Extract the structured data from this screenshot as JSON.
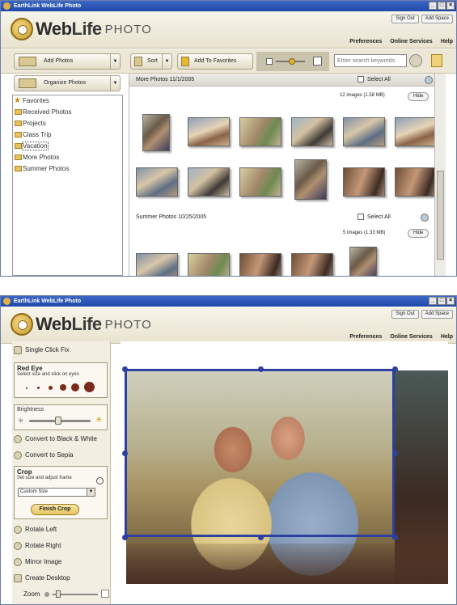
{
  "window1": {
    "title": "EarthLink WebLife Photo",
    "window_buttons": [
      "_",
      "□",
      "×"
    ],
    "logo": {
      "web": "Web",
      "life": "Life",
      "photo": "PHOTO"
    },
    "top_links": [
      "Sign Out",
      "Add Space"
    ],
    "nav_links": [
      "Preferences",
      "Online Services",
      "Help"
    ],
    "toolbar": {
      "add_photos": "Add Photos",
      "organize_photos": "Organize Photos",
      "sort": "Sort",
      "add_to_favorites": "Add To Favorites",
      "search_placeholder": "Enter search keywords"
    },
    "tree": [
      "Favorites",
      "Received Photos",
      "Projects",
      "Class Trip",
      "Vacation",
      "More Photos",
      "Summer Photos"
    ],
    "sections": [
      {
        "title": "More Photos  11/1/2005",
        "select_all": "Select All",
        "count": "12 images (1.58 MB)",
        "hide": "Hide"
      },
      {
        "title": "Summer Photos  10/25/2005",
        "select_all": "Select All",
        "count": "5 images (1.33 MB)",
        "hide": "Hide"
      }
    ]
  },
  "window2": {
    "title": "EarthLink WebLife Photo",
    "window_buttons": [
      "_",
      "□",
      "×"
    ],
    "logo": {
      "web": "Web",
      "life": "Life",
      "photo": "PHOTO"
    },
    "top_links": [
      "Sign Out",
      "Add Space"
    ],
    "nav_links": [
      "Preferences",
      "Online Services",
      "Help"
    ],
    "tools": {
      "single_click_fix": "Single Click Fix",
      "red_eye_title": "Red Eye",
      "red_eye_hint": "Select size and click on eyes",
      "brightness": "Brightness",
      "convert_bw": "Convert to Black & White",
      "convert_sepia": "Convert to Sepia",
      "crop_title": "Crop",
      "crop_hint": "Set size and adjust frame",
      "crop_size": "Custom Size",
      "finish_crop": "Finish Crop",
      "rotate_left": "Rotate Left",
      "rotate_right": "Rotate Right",
      "mirror_image": "Mirror Image",
      "create_desktop": "Create Desktop",
      "zoom": "Zoom"
    }
  }
}
